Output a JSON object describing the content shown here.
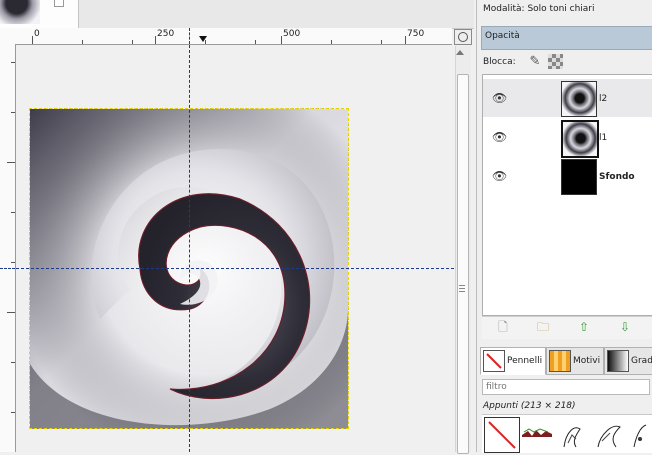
{
  "ruler": {
    "ticks": [
      "0",
      "250",
      "500",
      "750"
    ]
  },
  "dock": {
    "mode_label": "Modalità:",
    "mode_value": "Solo toni chiari",
    "opacity_label": "Opacità",
    "lock_label": "Blocca:"
  },
  "layers": [
    {
      "name": "l2",
      "visible": true,
      "selected": true,
      "bold": false
    },
    {
      "name": "l1",
      "visible": true,
      "selected": false,
      "bold": false
    },
    {
      "name": "Sfondo",
      "visible": true,
      "selected": false,
      "bold": true
    }
  ],
  "brushes": {
    "tabs": [
      "Pennelli",
      "Motivi",
      "Gradi"
    ],
    "filter_placeholder": "filtro",
    "current_label": "Appunti",
    "current_size": "(213 × 218)"
  },
  "colors": {
    "guide": "#1c3a8a",
    "selection_bar": "#b9c9d8",
    "boundary_yellow": "#e8d400"
  }
}
